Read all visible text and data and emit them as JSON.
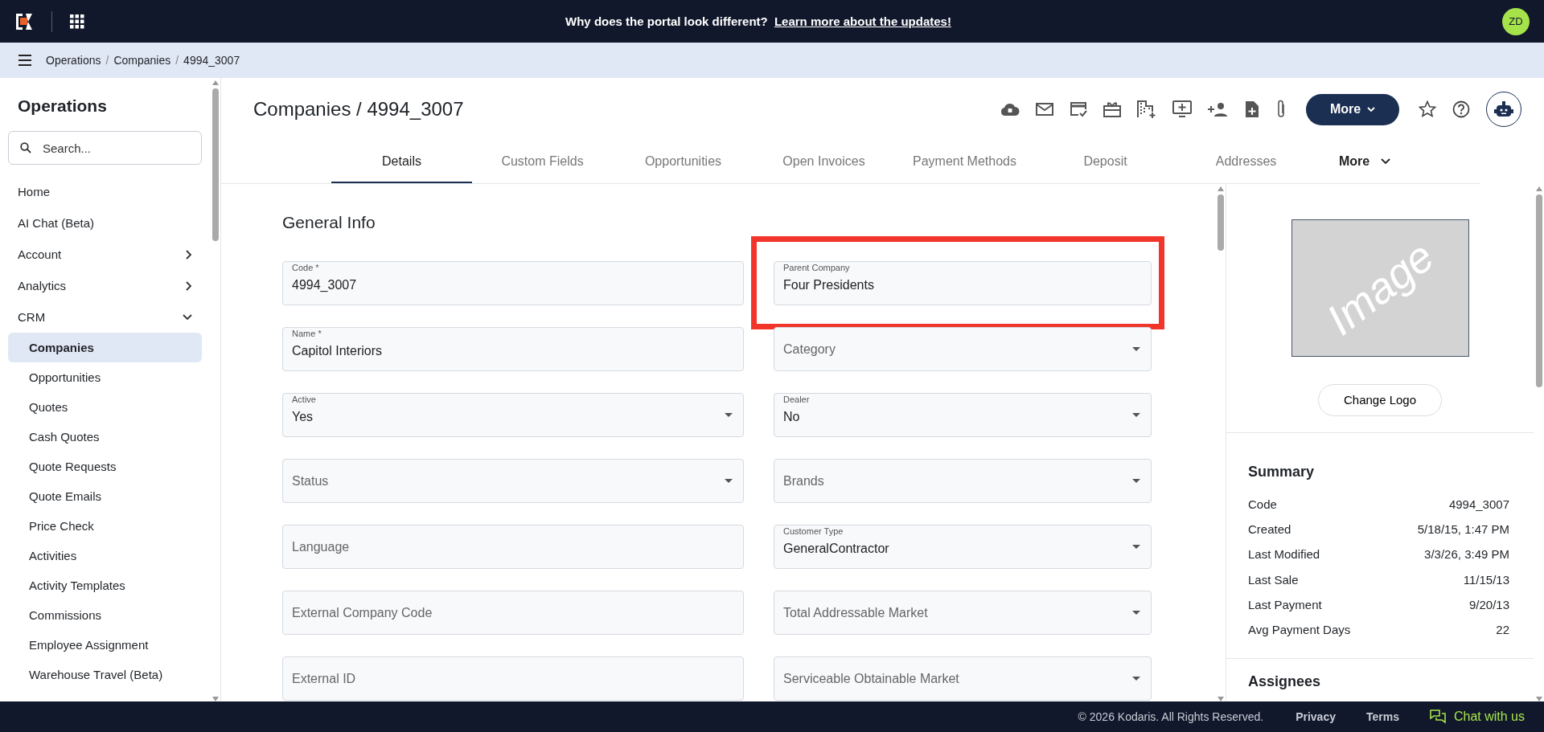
{
  "top_bar": {
    "announcement": "Why does the portal look different?",
    "announcement_link": "Learn more about the updates!",
    "avatar": "ZD"
  },
  "breadcrumb": {
    "separator": "/",
    "items": [
      "Operations",
      "Companies",
      "4994_3007"
    ]
  },
  "sidebar": {
    "title": "Operations",
    "search": {
      "placeholder": "Search..."
    },
    "items": [
      {
        "label": "Home"
      },
      {
        "label": "AI Chat (Beta)"
      },
      {
        "label": "Account",
        "expanded": false
      },
      {
        "label": "Analytics",
        "expanded": false
      },
      {
        "label": "CRM",
        "expanded": true,
        "children": [
          {
            "label": "Companies",
            "selected": true
          },
          {
            "label": "Opportunities",
            "selected": false
          },
          {
            "label": "Quotes",
            "selected": false
          },
          {
            "label": "Cash Quotes",
            "selected": false
          },
          {
            "label": "Quote Requests",
            "selected": false
          },
          {
            "label": "Quote Emails",
            "selected": false
          },
          {
            "label": "Price Check",
            "selected": false
          },
          {
            "label": "Activities",
            "selected": false
          },
          {
            "label": "Activity Templates",
            "selected": false
          },
          {
            "label": "Commissions",
            "selected": false
          },
          {
            "label": "Employee Assignment",
            "selected": false
          },
          {
            "label": "Warehouse Travel (Beta)",
            "selected": false
          }
        ]
      }
    ]
  },
  "page": {
    "title": "Companies / 4994_3007",
    "more_button": "More"
  },
  "tabs": [
    {
      "label": "Details",
      "selected": true,
      "kind": "tab"
    },
    {
      "label": "Custom Fields",
      "selected": false,
      "kind": "tab"
    },
    {
      "label": "Opportunities",
      "selected": false,
      "kind": "tab"
    },
    {
      "label": "Open Invoices",
      "selected": false,
      "kind": "tab"
    },
    {
      "label": "Payment Methods",
      "selected": false,
      "kind": "tab"
    },
    {
      "label": "Deposit",
      "selected": false,
      "kind": "tab"
    },
    {
      "label": "Addresses",
      "selected": false,
      "kind": "tab"
    },
    {
      "label": "More",
      "selected": false,
      "kind": "menu"
    }
  ],
  "general_info": {
    "title": "General Info",
    "rows": [
      {
        "fields": [
          {
            "kind": "text",
            "label": "Code *",
            "value": "4994_3007",
            "highlighted": false
          },
          {
            "kind": "text",
            "label": "Parent Company",
            "value": "Four Presidents",
            "highlighted": true
          }
        ]
      },
      {
        "fields": [
          {
            "kind": "text",
            "label": "Name *",
            "value": "Capitol Interiors",
            "highlighted": false
          },
          {
            "kind": "select",
            "placeholder": "Category",
            "highlighted": false
          }
        ]
      },
      {
        "fields": [
          {
            "kind": "select",
            "label": "Active",
            "value": "Yes",
            "highlighted": false
          },
          {
            "kind": "select",
            "label": "Dealer",
            "value": "No",
            "highlighted": false
          }
        ]
      },
      {
        "fields": [
          {
            "kind": "select",
            "placeholder": "Status",
            "highlighted": false
          },
          {
            "kind": "select",
            "placeholder": "Brands",
            "highlighted": false
          }
        ]
      },
      {
        "fields": [
          {
            "kind": "text",
            "placeholder": "Language",
            "highlighted": false
          },
          {
            "kind": "select",
            "label": "Customer Type",
            "value": "GeneralContractor",
            "highlighted": false
          }
        ]
      },
      {
        "fields": [
          {
            "kind": "text",
            "placeholder": "External Company Code",
            "highlighted": false
          },
          {
            "kind": "select",
            "placeholder": "Total Addressable Market",
            "highlighted": false
          }
        ]
      },
      {
        "fields": [
          {
            "kind": "text",
            "placeholder": "External ID",
            "highlighted": false
          },
          {
            "kind": "select",
            "placeholder": "Serviceable Obtainable Market",
            "highlighted": false
          }
        ]
      }
    ]
  },
  "logo": {
    "placeholder_text": "Image",
    "button": "Change Logo"
  },
  "summary": {
    "title": "Summary",
    "rows": [
      {
        "label": "Code",
        "value": "4994_3007"
      },
      {
        "label": "Created",
        "value": "5/18/15, 1:47 PM"
      },
      {
        "label": "Last Modified",
        "value": "3/3/26, 3:49 PM"
      },
      {
        "label": "Last Sale",
        "value": "11/15/13"
      },
      {
        "label": "Last Payment",
        "value": "9/20/13"
      },
      {
        "label": "Avg Payment Days",
        "value": "22"
      }
    ]
  },
  "assignees": {
    "title": "Assignees"
  },
  "footer": {
    "copyright": "© 2026 Kodaris. All Rights Reserved.",
    "links": [
      "Privacy",
      "Terms"
    ],
    "chat": "Chat with us"
  }
}
